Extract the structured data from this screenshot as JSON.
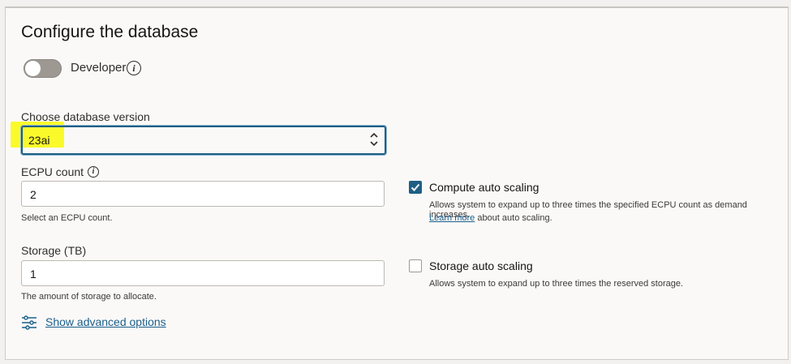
{
  "section": {
    "title": "Configure the database"
  },
  "developer": {
    "label": "Developer",
    "toggle_on": false,
    "info_icon": "info-icon"
  },
  "version": {
    "label": "Choose database version",
    "value": "23ai"
  },
  "ecpu": {
    "label": "ECPU count",
    "value": "2",
    "help": "Select an ECPU count."
  },
  "storage": {
    "label": "Storage (TB)",
    "value": "1",
    "help": "The amount of storage to allocate."
  },
  "advanced": {
    "label": "Show advanced options",
    "icon": "sliders-icon"
  },
  "compute_scaling": {
    "label": "Compute auto scaling",
    "checked": true,
    "help": "Allows system to expand up to three times the specified ECPU count as demand increases.",
    "link": "Learn more",
    "link_suffix": " about auto scaling."
  },
  "storage_scaling": {
    "label": "Storage auto scaling",
    "checked": false,
    "help": "Allows system to expand up to three times the reserved storage."
  },
  "colors": {
    "accent": "#1f5f84",
    "link": "#1a5f8a",
    "highlight": "#fafa2a"
  }
}
